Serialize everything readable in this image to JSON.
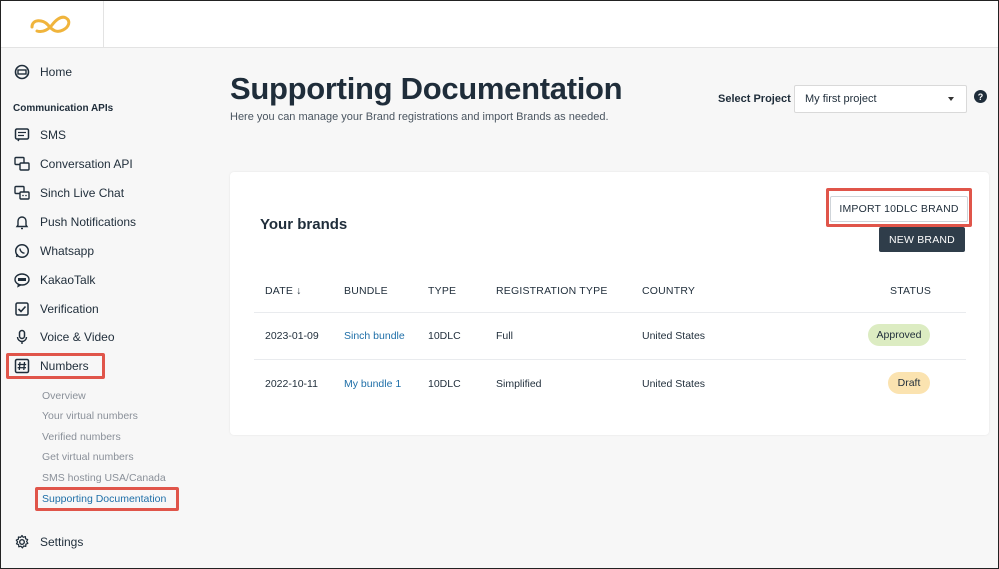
{
  "sidebar": {
    "home": "Home",
    "section": "Communication APIs",
    "items": [
      "SMS",
      "Conversation API",
      "Sinch Live Chat",
      "Push Notifications",
      "Whatsapp",
      "KakaoTalk",
      "Verification",
      "Voice & Video",
      "Numbers"
    ],
    "numbers_sub": [
      "Overview",
      "Your virtual numbers",
      "Verified numbers",
      "Get virtual numbers",
      "SMS hosting USA/Canada",
      "Supporting Documentation"
    ],
    "settings": "Settings"
  },
  "header": {
    "title": "Supporting Documentation",
    "subtitle": "Here you can manage your Brand registrations and import Brands as needed.",
    "project_label": "Select Project",
    "project_value": "My first project",
    "help": "?"
  },
  "card": {
    "title": "Your brands",
    "import_button": "IMPORT 10DLC BRAND",
    "new_button": "NEW BRAND",
    "columns": [
      "DATE ↓",
      "BUNDLE",
      "TYPE",
      "REGISTRATION TYPE",
      "COUNTRY",
      "STATUS"
    ],
    "rows": [
      [
        "2023-01-09",
        "Sinch bundle",
        "10DLC",
        "Full",
        "United States",
        "Approved"
      ],
      [
        "2022-10-11",
        "My bundle 1",
        "10DLC",
        "Simplified",
        "United States",
        "Draft"
      ]
    ]
  },
  "colors": {
    "highlight": "#e0554a",
    "link": "#1f6fa8",
    "approved_bg": "#dcecc2",
    "draft_bg": "#fbe3b0",
    "logo": "#f0b43c"
  }
}
